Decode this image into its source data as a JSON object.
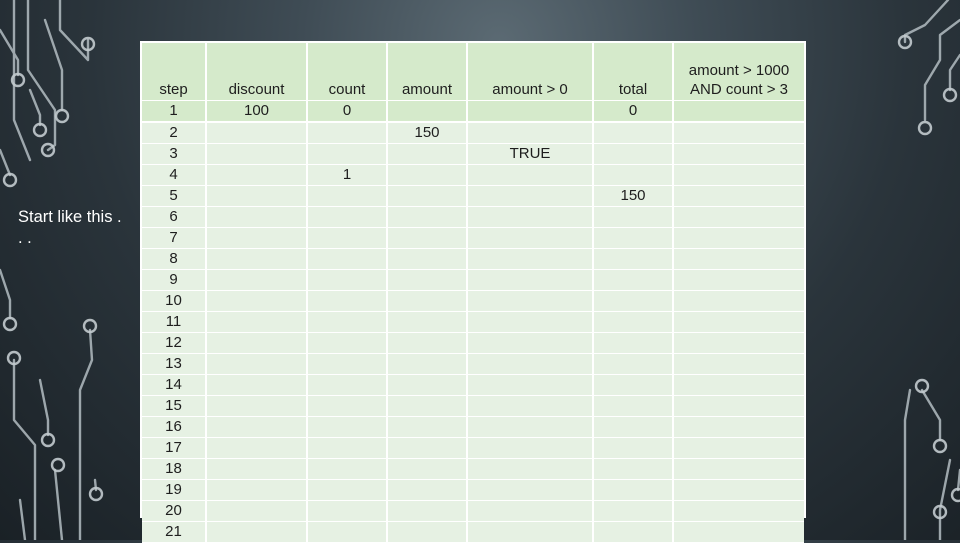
{
  "side_text": "Start like this . . .",
  "table": {
    "columns": [
      "step",
      "discount",
      "count",
      "amount",
      "amount > 0",
      "total",
      "amount > 1000 AND count > 3"
    ],
    "rows": [
      [
        "1",
        "100",
        "0",
        "",
        "",
        "0",
        ""
      ],
      [
        "2",
        "",
        "",
        "150",
        "",
        "",
        ""
      ],
      [
        "3",
        "",
        "",
        "",
        "TRUE",
        "",
        ""
      ],
      [
        "4",
        "",
        "1",
        "",
        "",
        "",
        ""
      ],
      [
        "5",
        "",
        "",
        "",
        "",
        "150",
        ""
      ],
      [
        "6",
        "",
        "",
        "",
        "",
        "",
        ""
      ],
      [
        "7",
        "",
        "",
        "",
        "",
        "",
        ""
      ],
      [
        "8",
        "",
        "",
        "",
        "",
        "",
        ""
      ],
      [
        "9",
        "",
        "",
        "",
        "",
        "",
        ""
      ],
      [
        "10",
        "",
        "",
        "",
        "",
        "",
        ""
      ],
      [
        "11",
        "",
        "",
        "",
        "",
        "",
        ""
      ],
      [
        "12",
        "",
        "",
        "",
        "",
        "",
        ""
      ],
      [
        "13",
        "",
        "",
        "",
        "",
        "",
        ""
      ],
      [
        "14",
        "",
        "",
        "",
        "",
        "",
        ""
      ],
      [
        "15",
        "",
        "",
        "",
        "",
        "",
        ""
      ],
      [
        "16",
        "",
        "",
        "",
        "",
        "",
        ""
      ],
      [
        "17",
        "",
        "",
        "",
        "",
        "",
        ""
      ],
      [
        "18",
        "",
        "",
        "",
        "",
        "",
        ""
      ],
      [
        "19",
        "",
        "",
        "",
        "",
        "",
        ""
      ],
      [
        "20",
        "",
        "",
        "",
        "",
        "",
        ""
      ],
      [
        "21",
        "",
        "",
        "",
        "",
        "",
        ""
      ]
    ]
  },
  "colors": {
    "header_fill": "#d5eacb",
    "body_fill": "#e6f1e3",
    "circuit_lines": "#b9c2c7",
    "text": "#1e1e1e"
  }
}
